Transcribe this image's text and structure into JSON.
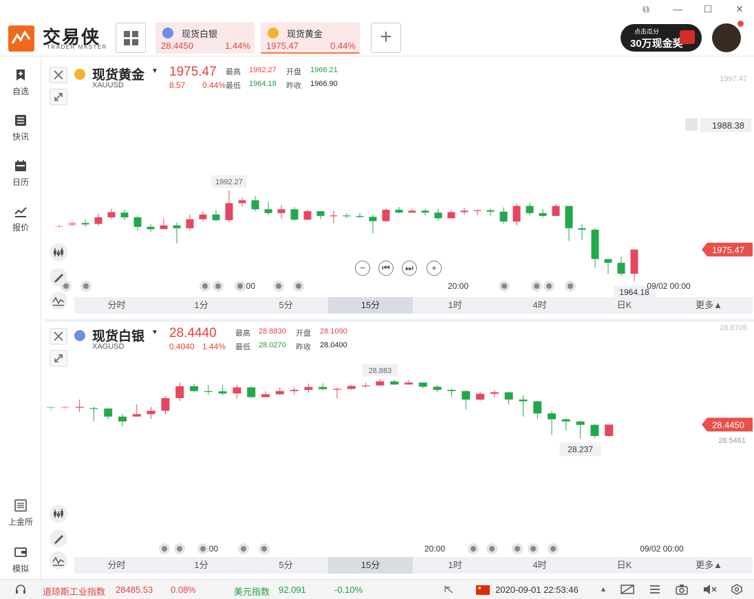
{
  "app": {
    "name": "交易侠",
    "subtitle": "TRADER MASTER"
  },
  "header": {
    "tabs": [
      {
        "name": "现货白银",
        "price": "28.4450",
        "pct": "1.44%"
      },
      {
        "name": "现货黄金",
        "price": "1975.47",
        "pct": "0.44%"
      }
    ],
    "promo": {
      "line1": "点击瓜分",
      "line2": "30万现金奖"
    }
  },
  "sidebar": {
    "items": [
      {
        "label": "自选",
        "icon": "bookmark-add-icon"
      },
      {
        "label": "快讯",
        "icon": "news-list-icon"
      },
      {
        "label": "日历",
        "icon": "calendar-icon"
      },
      {
        "label": "报价",
        "icon": "trend-line-icon"
      },
      {
        "label": "上金所",
        "icon": "sge-icon"
      },
      {
        "label": "模拟",
        "icon": "wallet-icon"
      }
    ]
  },
  "gold": {
    "name": "现货黄金",
    "code": "XAUUSD",
    "price": "1975.47",
    "change": "8.57",
    "pct": "0.44%",
    "high_label": "最高",
    "high": "1992.27",
    "open_label": "开盘",
    "open": "1966.21",
    "low_label": "最低",
    "low": "1964.18",
    "prev_label": "昨收",
    "prev": "1966.90",
    "axis_top": "1997.47",
    "alert_price": "1988.38",
    "current_tag": "1975.47",
    "max_tag": "1992.27",
    "min_tag": "1964.18",
    "time_labels": [
      "16:00",
      "20:00",
      "09/02 00:00"
    ]
  },
  "silver": {
    "name": "现货白银",
    "code": "XAGUSD",
    "price": "28.4440",
    "change": "0.4040",
    "pct": "1.44%",
    "high_label": "最高",
    "high": "28.8830",
    "open_label": "开盘",
    "open": "28.1090",
    "low_label": "最低",
    "low": "28.0270",
    "prev_label": "昨收",
    "prev": "28.0400",
    "axis_top": "28.8705",
    "axis_mid": "28.5461",
    "current_tag": "28.4450",
    "max_tag": "28.883",
    "min_tag": "28.237",
    "time_labels": [
      "16:00",
      "20:00",
      "09/02 00:00"
    ]
  },
  "timeframes": [
    "分时",
    "1分",
    "5分",
    "15分",
    "1时",
    "4时",
    "日K",
    "更多▲"
  ],
  "active_timeframe": "15分",
  "bottom": {
    "dow_label": "道琼斯工业指数",
    "dow_value": "28485.53",
    "dow_pct": "0.08%",
    "usd_label": "美元指数",
    "usd_value": "92.091",
    "usd_pct": "-0.10%",
    "datetime": "2020-09-01  22:53:46"
  },
  "colors": {
    "up": "#e8465e",
    "down": "#22a94a",
    "accent": "#f06a1e"
  },
  "chart_data": [
    {
      "type": "candlestick",
      "title": "现货黄金 XAUUSD",
      "ylim": [
        1960,
        1997.47
      ],
      "candles": [
        [
          1967.0,
          1967.2,
          1966.6,
          1967.6
        ],
        [
          1967.3,
          1967.9,
          1967.1,
          1968.4
        ],
        [
          1967.8,
          1967.5,
          1967.0,
          1968.6
        ],
        [
          1967.6,
          1969.0,
          1967.2,
          1969.8
        ],
        [
          1969.0,
          1970.1,
          1968.6,
          1970.8
        ],
        [
          1970.0,
          1969.0,
          1968.5,
          1970.6
        ],
        [
          1969.0,
          1967.0,
          1966.2,
          1969.3
        ],
        [
          1967.0,
          1966.5,
          1965.9,
          1967.6
        ],
        [
          1966.5,
          1967.3,
          1966.8,
          1968.8
        ],
        [
          1967.3,
          1966.7,
          1963.5,
          1967.9
        ],
        [
          1966.7,
          1968.6,
          1966.3,
          1969.6
        ],
        [
          1968.6,
          1969.6,
          1968.1,
          1970.3
        ],
        [
          1969.6,
          1968.4,
          1968.2,
          1970.6
        ],
        [
          1968.4,
          1972.0,
          1968.0,
          1974.7
        ],
        [
          1972.0,
          1972.6,
          1971.3,
          1973.2
        ],
        [
          1972.6,
          1970.7,
          1970.3,
          1973.5
        ],
        [
          1970.7,
          1969.9,
          1969.5,
          1972.2
        ],
        [
          1969.9,
          1970.7,
          1968.7,
          1971.6
        ],
        [
          1970.7,
          1968.5,
          1968.3,
          1971.2
        ],
        [
          1968.5,
          1970.3,
          1968.4,
          1970.6
        ],
        [
          1970.3,
          1969.3,
          1968.6,
          1969.8
        ],
        [
          1969.3,
          1969.4,
          1967.8,
          1970.4
        ],
        [
          1969.4,
          1969.3,
          1968.8,
          1969.9
        ],
        [
          1969.3,
          1969.1,
          1968.8,
          1969.9
        ],
        [
          1969.1,
          1968.2,
          1965.6,
          1969.6
        ],
        [
          1968.2,
          1970.6,
          1968.0,
          1970.9
        ],
        [
          1970.6,
          1970.0,
          1969.8,
          1971.2
        ],
        [
          1970.0,
          1970.4,
          1970.0,
          1970.8
        ],
        [
          1970.4,
          1970.0,
          1969.4,
          1970.8
        ],
        [
          1970.0,
          1968.8,
          1968.3,
          1970.8
        ],
        [
          1968.8,
          1970.1,
          1969.1,
          1970.6
        ],
        [
          1970.1,
          1970.4,
          1969.6,
          1971.0
        ],
        [
          1970.4,
          1970.5,
          1969.4,
          1970.6
        ],
        [
          1970.5,
          1970.2,
          1969.4,
          1970.8
        ],
        [
          1970.2,
          1968.1,
          1967.6,
          1971.1
        ],
        [
          1968.1,
          1971.4,
          1967.3,
          1971.9
        ],
        [
          1971.4,
          1969.9,
          1969.4,
          1972.0
        ],
        [
          1969.9,
          1969.3,
          1969.0,
          1970.8
        ],
        [
          1969.3,
          1971.4,
          1969.3,
          1971.8
        ],
        [
          1971.4,
          1966.7,
          1964.0,
          1971.4
        ],
        [
          1966.7,
          1966.4,
          1964.2,
          1967.6
        ],
        [
          1966.4,
          1960.2,
          1958.4,
          1966.7
        ],
        [
          1960.2,
          1959.4,
          1957.1,
          1960.2
        ],
        [
          1959.4,
          1957.1,
          1956.6,
          1960.7
        ],
        [
          1957.1,
          1962.2,
          1955.5,
          1962.2
        ]
      ]
    },
    {
      "type": "candlestick",
      "title": "现货白银 XAGUSD",
      "ylim": [
        28.1,
        28.8705
      ],
      "candles": [
        [
          28.56,
          28.555,
          28.54,
          28.56
        ],
        [
          28.556,
          28.56,
          28.55,
          28.565
        ],
        [
          28.56,
          28.56,
          28.54,
          28.59
        ],
        [
          28.555,
          28.553,
          28.5,
          28.56
        ],
        [
          28.553,
          28.52,
          28.51,
          28.555
        ],
        [
          28.52,
          28.5,
          28.48,
          28.53
        ],
        [
          28.52,
          28.53,
          28.52,
          28.57
        ],
        [
          28.53,
          28.544,
          28.51,
          28.56
        ],
        [
          28.544,
          28.596,
          28.53,
          28.604
        ],
        [
          28.596,
          28.645,
          28.584,
          28.66
        ],
        [
          28.645,
          28.625,
          28.621,
          28.655
        ],
        [
          28.625,
          28.624,
          28.61,
          28.65
        ],
        [
          28.624,
          28.615,
          28.608,
          28.65
        ],
        [
          28.615,
          28.64,
          28.594,
          28.652
        ],
        [
          28.64,
          28.6,
          28.597,
          28.645
        ],
        [
          28.6,
          28.612,
          28.608,
          28.625
        ],
        [
          28.612,
          28.625,
          28.61,
          28.64
        ],
        [
          28.625,
          28.63,
          28.61,
          28.64
        ],
        [
          28.63,
          28.642,
          28.618,
          28.656
        ],
        [
          28.642,
          28.633,
          28.628,
          28.657
        ],
        [
          28.633,
          28.634,
          28.595,
          28.64
        ],
        [
          28.634,
          28.646,
          28.63,
          28.65
        ],
        [
          28.646,
          28.648,
          28.64,
          28.66
        ],
        [
          28.648,
          28.665,
          28.647,
          28.674
        ],
        [
          28.665,
          28.652,
          28.65,
          28.672
        ],
        [
          28.652,
          28.66,
          28.652,
          28.67
        ],
        [
          28.66,
          28.643,
          28.636,
          28.66
        ],
        [
          28.643,
          28.63,
          28.62,
          28.648
        ],
        [
          28.63,
          28.625,
          28.6,
          28.635
        ],
        [
          28.625,
          28.59,
          28.55,
          28.628
        ],
        [
          28.59,
          28.614,
          28.585,
          28.622
        ],
        [
          28.614,
          28.62,
          28.6,
          28.628
        ],
        [
          28.62,
          28.59,
          28.57,
          28.622
        ],
        [
          28.59,
          28.583,
          28.52,
          28.608
        ],
        [
          28.583,
          28.533,
          28.51,
          28.585
        ],
        [
          28.533,
          28.509,
          28.444,
          28.543
        ],
        [
          28.509,
          28.5,
          28.462,
          28.512
        ],
        [
          28.5,
          28.486,
          28.43,
          28.503
        ],
        [
          28.486,
          28.44,
          28.432,
          28.488
        ],
        [
          28.44,
          28.487,
          28.437,
          28.487
        ]
      ]
    }
  ]
}
